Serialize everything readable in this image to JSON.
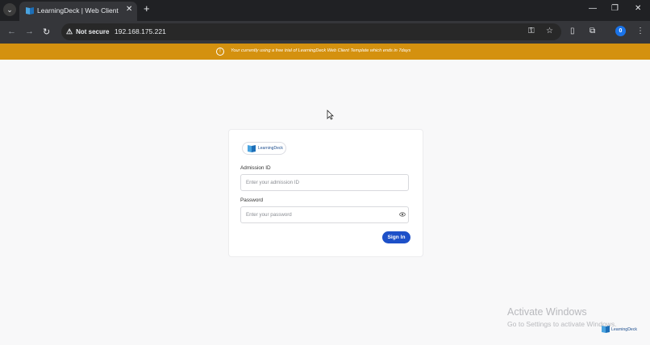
{
  "browser": {
    "tab_title": "LearningDeck | Web Client",
    "tab_close_icon": "close-icon",
    "new_tab_icon": "plus-icon",
    "security_label": "Not secure",
    "url": "192.168.175.221",
    "profile_initial": "0"
  },
  "banner": {
    "text": "Your currently using a free trial of LearningDeck Web Client Template which ends in 7days",
    "color": "#d4910f"
  },
  "login": {
    "logo_text": "LearningDeck",
    "admission_label": "Admission ID",
    "admission_placeholder": "Enter your admission ID",
    "password_label": "Password",
    "password_placeholder": "Enter your password",
    "signin_label": "Sign In",
    "accent": "#1d50c8"
  },
  "watermark": {
    "title": "Activate Windows",
    "subtitle": "Go to Settings to activate Windows."
  },
  "corner_logo_text": "LearningDeck"
}
